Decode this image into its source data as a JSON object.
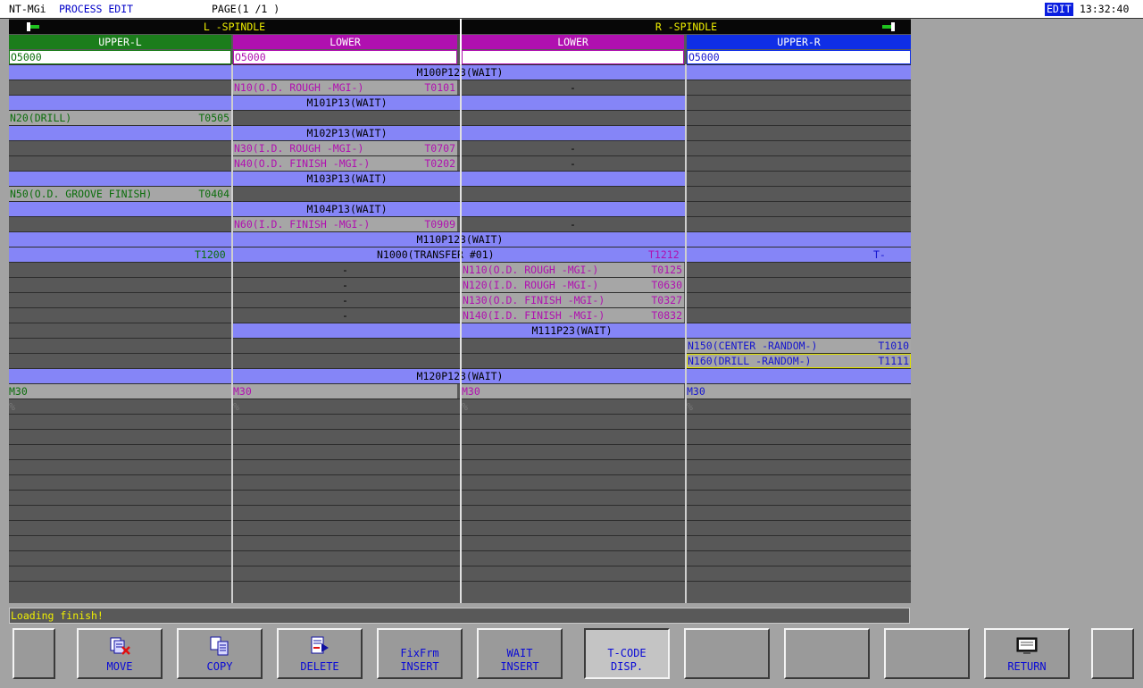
{
  "titlebar": {
    "app": "NT-MGi",
    "screen": "PROCESS EDIT",
    "page": "PAGE(1 /1 )",
    "mode": "EDIT",
    "time": "13:32:40"
  },
  "spindles": {
    "left": "L -SPINDLE",
    "right": "R -SPINDLE"
  },
  "turrets": [
    "UPPER-L",
    "LOWER",
    "LOWER",
    "UPPER-R"
  ],
  "programs": [
    "O5000",
    "O5000",
    "",
    "O5000"
  ],
  "colors": {
    "upper_l": "#1b7d1b",
    "lower": "#b010b0",
    "upper_r": "#0f2ee6",
    "wait": "#8585f7",
    "header_text": "#f0f000"
  },
  "rows": [
    {
      "wait": "M100P123(WAIT)"
    },
    {
      "c2": {
        "text": "N10(O.D. ROUGH -MGI-)",
        "tool": "T0101"
      },
      "c3": "-"
    },
    {
      "wait": "M101P13(WAIT)"
    },
    {
      "c1": {
        "text": "N20(DRILL)",
        "tool": "T0505"
      }
    },
    {
      "wait": "M102P13(WAIT)"
    },
    {
      "c2": {
        "text": "N30(I.D. ROUGH -MGI-)",
        "tool": "T0707"
      },
      "c3": "-"
    },
    {
      "c2": {
        "text": "N40(O.D. FINISH -MGI-)",
        "tool": "T0202"
      },
      "c3": "-"
    },
    {
      "wait": "M103P13(WAIT)"
    },
    {
      "c1": {
        "text": "N50(O.D. GROOVE FINISH)",
        "tool": "T0404"
      }
    },
    {
      "wait": "M104P13(WAIT)"
    },
    {
      "c2": {
        "text": "N60(I.D. FINISH -MGI-)",
        "tool": "T0909"
      },
      "c3": "-"
    },
    {
      "wait": "M110P123(WAIT)"
    },
    {
      "transfer": {
        "t1": "T1200",
        "text": "N1000(TRANSFER #01)",
        "t3": "T1212",
        "t4": "T-"
      }
    },
    {
      "c2": "-",
      "c3": {
        "text": "N110(O.D. ROUGH -MGI-)",
        "tool": "T0125"
      }
    },
    {
      "c2": "-",
      "c3": {
        "text": "N120(I.D. ROUGH -MGI-)",
        "tool": "T0630"
      }
    },
    {
      "c2": "-",
      "c3": {
        "text": "N130(O.D. FINISH -MGI-)",
        "tool": "T0327"
      }
    },
    {
      "c2": "-",
      "c3": {
        "text": "N140(I.D. FINISH -MGI-)",
        "tool": "T0832"
      }
    },
    {
      "wait": "M111P23(WAIT)"
    },
    {
      "c4": {
        "text": "N150(CENTER -RANDOM-)",
        "tool": "T1010"
      }
    },
    {
      "c4": {
        "text": "N160(DRILL -RANDOM-)",
        "tool": "T1111"
      }
    },
    {
      "wait": "M120P123(WAIT)"
    },
    {
      "all": "M30"
    },
    {
      "all": "%"
    }
  ],
  "status": "Loading finish!",
  "softkeys": [
    "",
    "MOVE",
    "COPY",
    "DELETE",
    "FixFrm\nINSERT",
    "WAIT\nINSERT",
    "T-CODE\nDISP.",
    "",
    "",
    "",
    "RETURN",
    ""
  ],
  "softkey_icons": [
    "",
    "move-icon",
    "copy-icon",
    "delete-icon",
    "",
    "",
    "",
    "",
    "",
    "",
    "return-icon",
    ""
  ]
}
